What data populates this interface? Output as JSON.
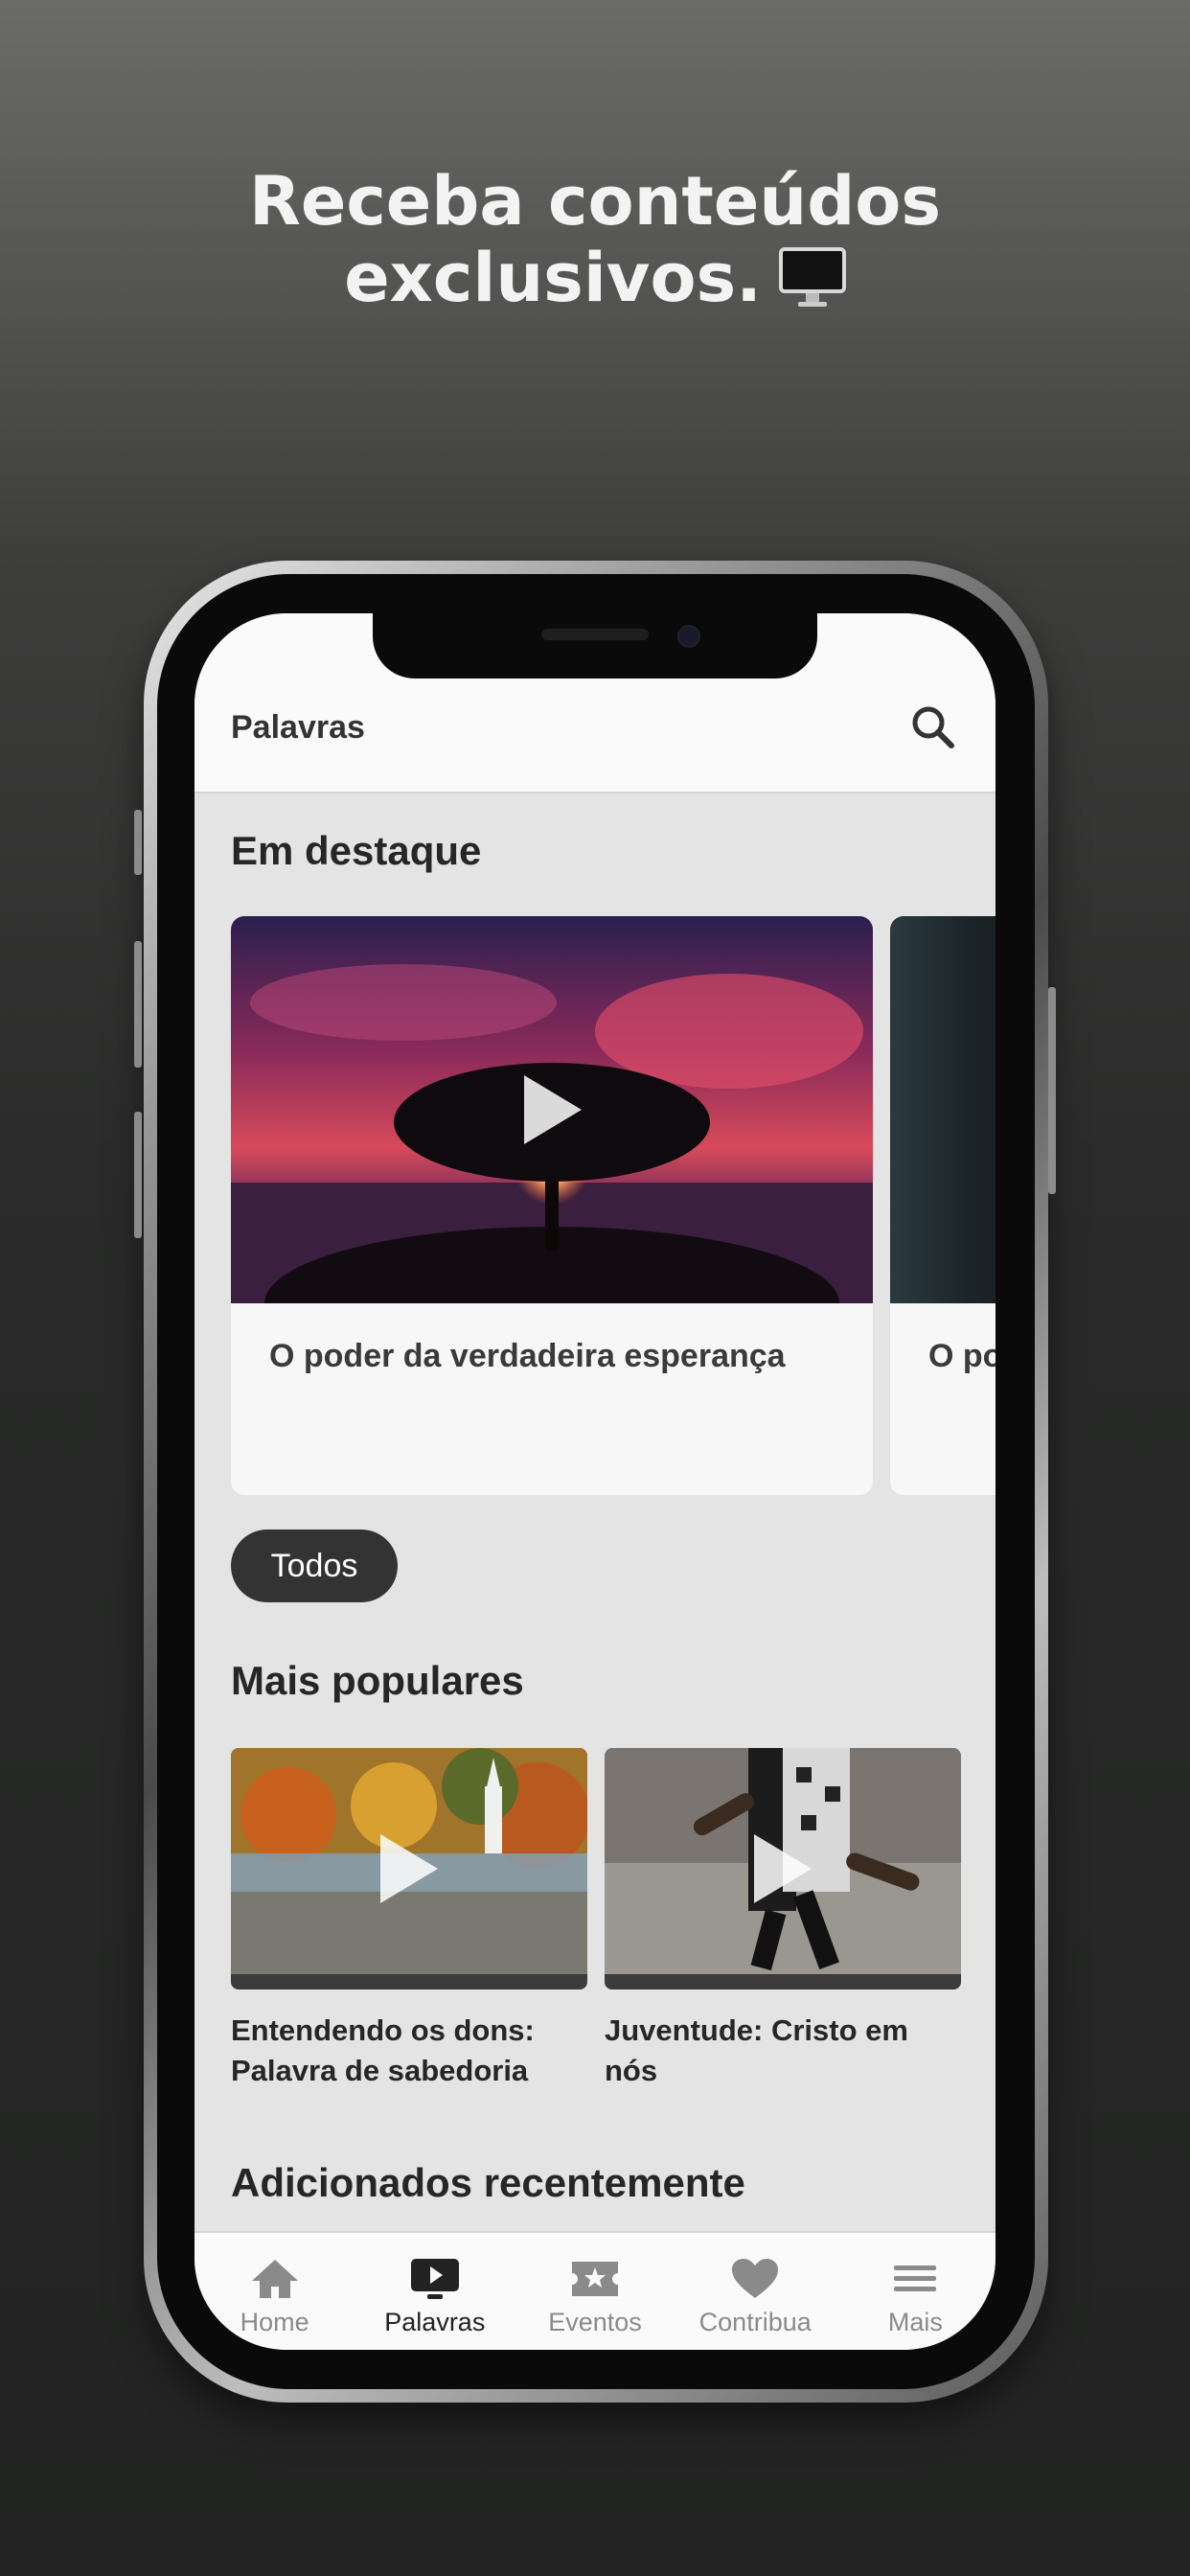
{
  "headline": {
    "line1": "Receba conteúdos",
    "line2": "exclusivos."
  },
  "header": {
    "title": "Palavras"
  },
  "featured": {
    "section_title": "Em destaque",
    "cards": [
      {
        "title": "O poder da verdadeira esperança"
      },
      {
        "title": "O po"
      }
    ]
  },
  "filter_chip": "Todos",
  "popular": {
    "section_title": "Mais populares",
    "items": [
      {
        "title": "Entendendo os dons: Palavra de sabedoria"
      },
      {
        "title": "Juventude: Cristo em nós"
      }
    ]
  },
  "recent": {
    "section_title": "Adicionados recentemente"
  },
  "tabbar": {
    "tabs": [
      {
        "label": "Home",
        "icon": "home-icon"
      },
      {
        "label": "Palavras",
        "icon": "video-play-icon",
        "active": true
      },
      {
        "label": "Eventos",
        "icon": "ticket-star-icon"
      },
      {
        "label": "Contribua",
        "icon": "heart-icon"
      },
      {
        "label": "Mais",
        "icon": "menu-icon"
      }
    ]
  },
  "colors": {
    "accent_dark": "#333333",
    "inactive_tab": "#8a8a8a"
  }
}
